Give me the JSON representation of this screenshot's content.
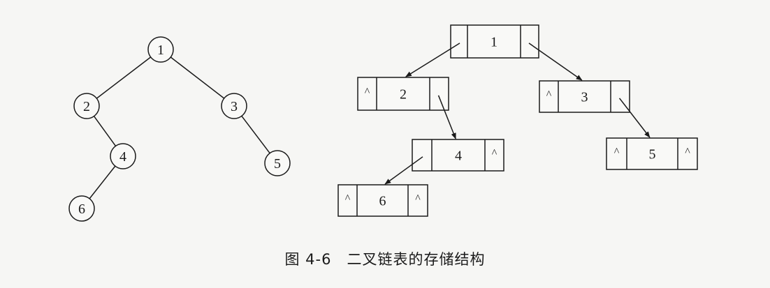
{
  "tree": {
    "nodes": [
      {
        "id": "1",
        "label": "1"
      },
      {
        "id": "2",
        "label": "2"
      },
      {
        "id": "3",
        "label": "3"
      },
      {
        "id": "4",
        "label": "4"
      },
      {
        "id": "5",
        "label": "5"
      },
      {
        "id": "6",
        "label": "6"
      }
    ],
    "edges": [
      {
        "from": "1",
        "to": "2"
      },
      {
        "from": "1",
        "to": "3"
      },
      {
        "from": "2",
        "to": "4"
      },
      {
        "from": "4",
        "to": "6"
      },
      {
        "from": "3",
        "to": "5"
      }
    ]
  },
  "linked": {
    "null_symbol": "^",
    "nodes": [
      {
        "id": "1",
        "data": "1",
        "left": "",
        "right": ""
      },
      {
        "id": "2",
        "data": "2",
        "left": "^",
        "right": ""
      },
      {
        "id": "3",
        "data": "3",
        "left": "^",
        "right": ""
      },
      {
        "id": "4",
        "data": "4",
        "left": "",
        "right": "^"
      },
      {
        "id": "5",
        "data": "5",
        "left": "^",
        "right": "^"
      },
      {
        "id": "6",
        "data": "6",
        "left": "^",
        "right": "^"
      }
    ],
    "links": [
      {
        "from": "1",
        "side": "left",
        "to": "2"
      },
      {
        "from": "1",
        "side": "right",
        "to": "3"
      },
      {
        "from": "2",
        "side": "right",
        "to": "4"
      },
      {
        "from": "4",
        "side": "left",
        "to": "6"
      },
      {
        "from": "3",
        "side": "right",
        "to": "5"
      }
    ]
  },
  "caption": {
    "number": "图 4-6",
    "text": "二叉链表的存储结构"
  }
}
